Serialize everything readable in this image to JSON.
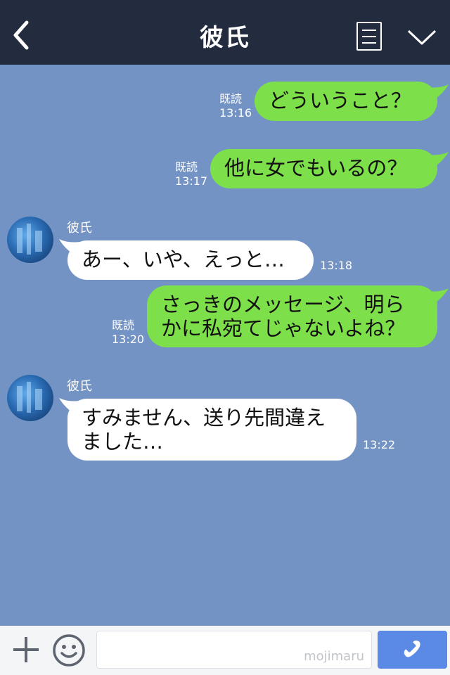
{
  "header": {
    "title": "彼氏"
  },
  "messages": [
    {
      "text": "どういうこと？",
      "read": "既読",
      "time": "13:16"
    },
    {
      "text": "他に女でもいるの？",
      "read": "既読",
      "time": "13:17"
    },
    {
      "sender": "彼氏",
      "text": "あー、いや、えっと…",
      "time": "13:18"
    },
    {
      "text_line1": "さっきのメッセージ、明ら",
      "text_line2": "かに私宛てじゃないよね？",
      "read": "既読",
      "time": "13:20"
    },
    {
      "sender": "彼氏",
      "text_line1": "すみません、送り先間違え",
      "text_line2": "ました…",
      "time": "13:22"
    }
  ],
  "footer": {
    "placeholder": "mojimaru"
  },
  "colors": {
    "header": "#232b3f",
    "background": "#7393c4",
    "my_bubble": "#7ddf4a",
    "their_bubble": "#ffffff",
    "call_button": "#5a8ae6"
  },
  "icons": [
    "back-icon",
    "menu-icon",
    "chevron-down-icon",
    "plus-icon",
    "smile-icon",
    "phone-icon"
  ]
}
